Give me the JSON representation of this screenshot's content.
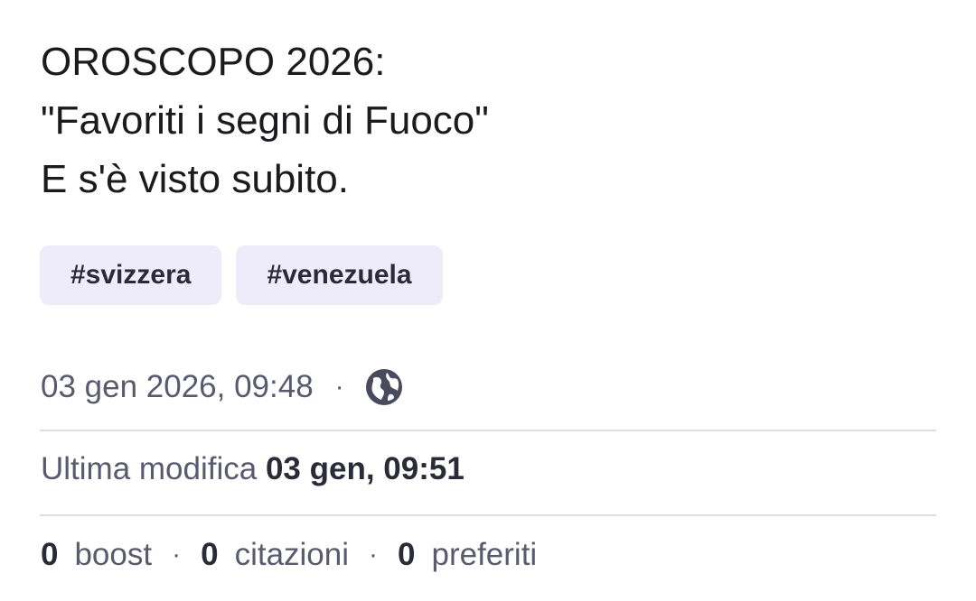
{
  "post": {
    "lines": [
      "OROSCOPO 2026:",
      "\"Favoriti i segni di Fuoco\"",
      "E s'è visto subito."
    ],
    "tags": [
      "#svizzera",
      "#venezuela"
    ],
    "timestamp": "03 gen 2026, 09:48",
    "separator": "·",
    "visibility_icon": "globe-icon",
    "edited_label": "Ultima modifica ",
    "edited_time": "03 gen, 09:51",
    "stats": {
      "boosts_count": "0",
      "boosts_label": "boost",
      "quotes_count": "0",
      "quotes_label": "citazioni",
      "favourites_count": "0",
      "favourites_label": "preferiti"
    }
  },
  "colors": {
    "tag_background": "#efecfa",
    "text_primary": "#1a1a1f",
    "text_secondary": "#5a5a6e",
    "divider": "#dcdce3"
  }
}
